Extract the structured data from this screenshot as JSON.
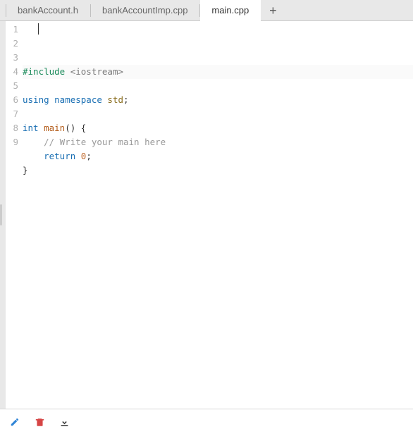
{
  "tabs": {
    "items": [
      {
        "label": "bankAccount.h",
        "active": false
      },
      {
        "label": "bankAccountImp.cpp",
        "active": false
      },
      {
        "label": "main.cpp",
        "active": true
      }
    ],
    "plus": "+"
  },
  "gutter": [
    "1",
    "2",
    "3",
    "4",
    "5",
    "6",
    "7",
    "8",
    "9"
  ],
  "code": {
    "lines": [
      {
        "tokens": [
          {
            "t": "#include ",
            "c": "tok-pre"
          },
          {
            "t": "<iostream>",
            "c": "tok-inc"
          }
        ]
      },
      {
        "tokens": []
      },
      {
        "tokens": [
          {
            "t": "using ",
            "c": "tok-kw"
          },
          {
            "t": "namespace ",
            "c": "tok-kw"
          },
          {
            "t": "std",
            "c": "tok-ns"
          },
          {
            "t": ";",
            "c": ""
          }
        ]
      },
      {
        "tokens": []
      },
      {
        "tokens": [
          {
            "t": "int ",
            "c": "tok-kw"
          },
          {
            "t": "main",
            "c": "tok-fn"
          },
          {
            "t": "() {",
            "c": ""
          }
        ]
      },
      {
        "tokens": [
          {
            "t": "    ",
            "c": ""
          },
          {
            "t": "// Write your main here",
            "c": "tok-comm"
          }
        ]
      },
      {
        "tokens": [
          {
            "t": "    ",
            "c": ""
          },
          {
            "t": "return ",
            "c": "tok-kw"
          },
          {
            "t": "0",
            "c": "tok-num"
          },
          {
            "t": ";",
            "c": ""
          }
        ]
      },
      {
        "tokens": [
          {
            "t": "}",
            "c": ""
          }
        ]
      },
      {
        "tokens": []
      }
    ]
  },
  "footer": {
    "edit_icon": "pencil-icon",
    "delete_icon": "trash-icon",
    "download_icon": "download-icon",
    "edit_color": "#2f84d6",
    "delete_color": "#d64545",
    "download_color": "#404040"
  }
}
